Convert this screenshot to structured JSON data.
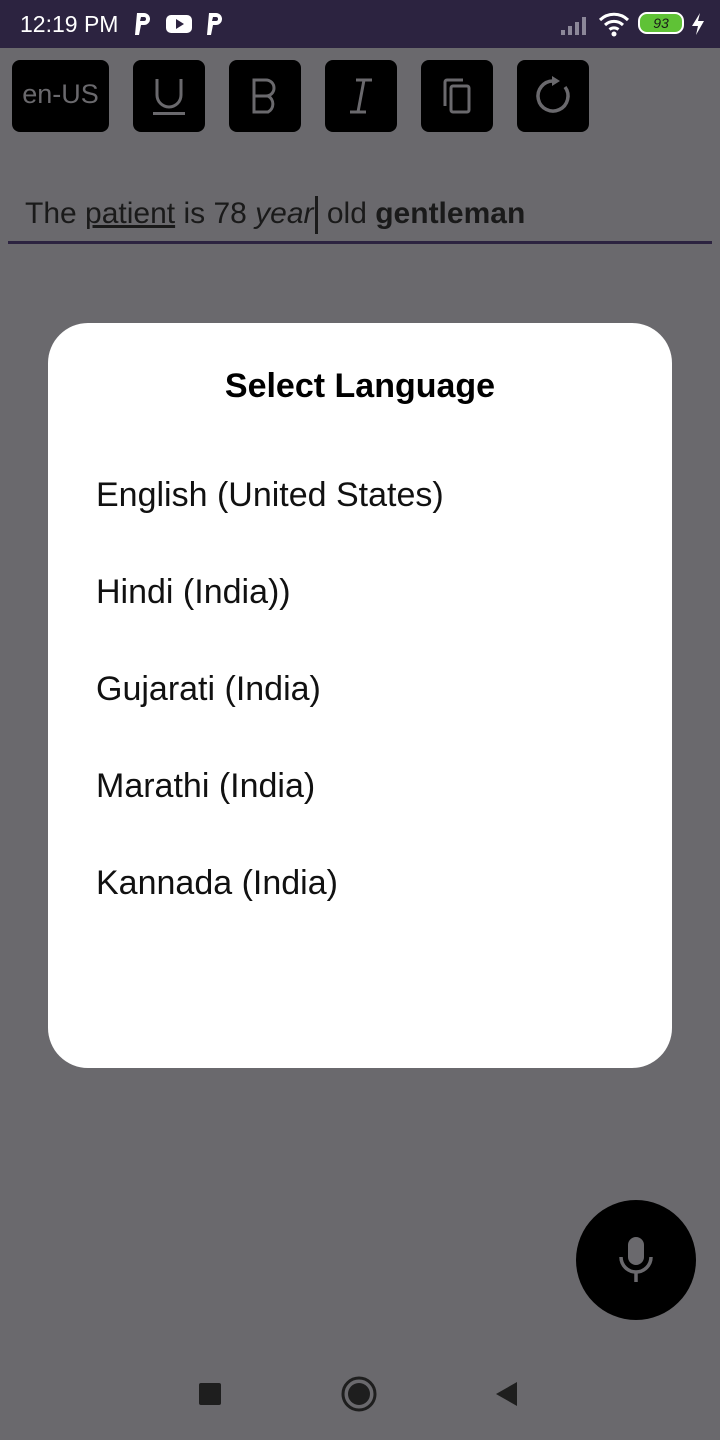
{
  "status_bar": {
    "time": "12:19 PM",
    "battery_level": "93",
    "icons": [
      "parking-app-icon",
      "youtube-icon",
      "parking-app-icon",
      "signal-icon",
      "wifi-icon",
      "battery-icon",
      "charging-icon"
    ]
  },
  "toolbar": {
    "language_button_label": "en-US",
    "buttons": [
      "underline-icon",
      "bold-icon",
      "italic-icon",
      "copy-icon",
      "refresh-icon"
    ]
  },
  "editor": {
    "segments": {
      "s1": "The ",
      "s2": "patient",
      "s3": " is 78 ",
      "s4": "year",
      "s5": " old ",
      "s6": "gentleman"
    }
  },
  "dialog": {
    "title": "Select Language",
    "options": [
      "English (United States)",
      "Hindi (India))",
      "Gujarati (India)",
      "Marathi (India)",
      "Kannada (India)"
    ]
  },
  "fab": {
    "icon": "microphone-icon"
  },
  "nav_bar": {
    "icons": [
      "recent-apps-icon",
      "home-icon",
      "back-icon"
    ]
  },
  "colors": {
    "status_bar_bg": "#2c2340",
    "scrim_bg": "#6a696d",
    "dialog_bg": "#ffffff",
    "button_bg": "#000000",
    "battery_fill": "#5fc236"
  }
}
